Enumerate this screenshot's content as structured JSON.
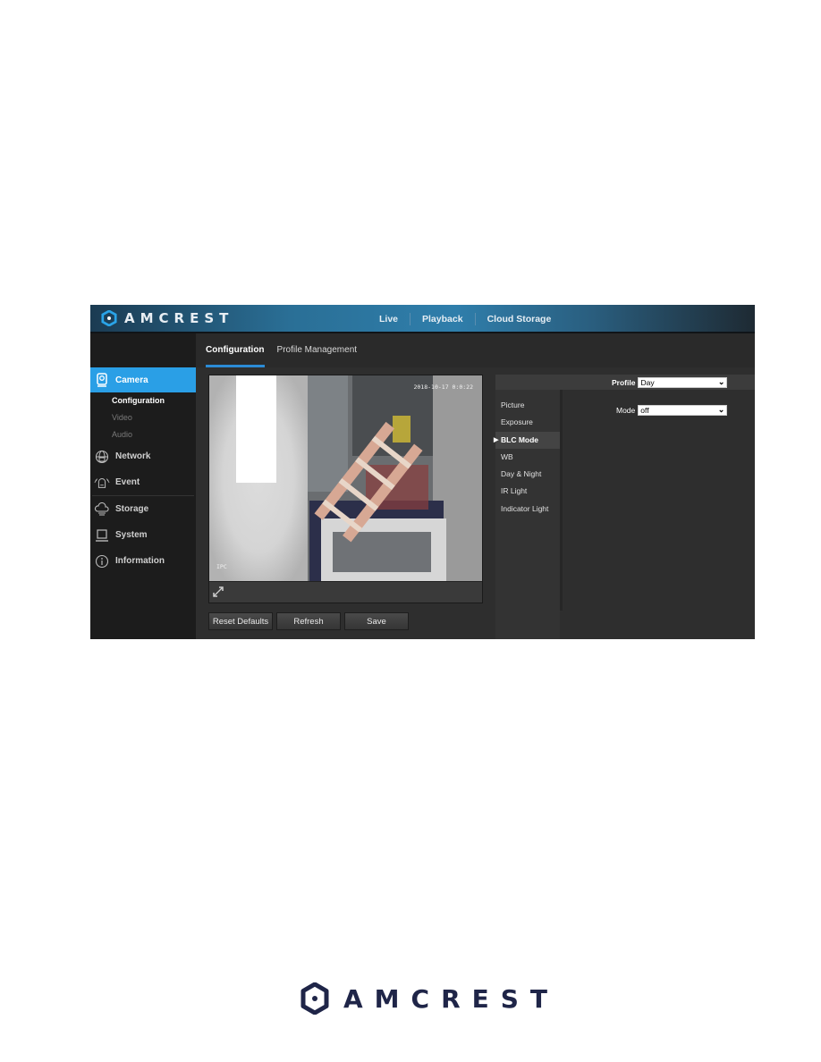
{
  "app": {
    "brand": "AMCREST",
    "top_nav": [
      {
        "label": "Live"
      },
      {
        "label": "Playback"
      },
      {
        "label": "Cloud Storage"
      }
    ],
    "tabs": [
      {
        "label": "Configuration",
        "active": true
      },
      {
        "label": "Profile Management",
        "active": false
      }
    ],
    "sidebar": {
      "camera": {
        "label": "Camera",
        "icon": "camera-icon"
      },
      "camera_subitems": [
        {
          "label": "Configuration",
          "active": true
        },
        {
          "label": "Video",
          "active": false
        },
        {
          "label": "Audio",
          "active": false
        }
      ],
      "network": {
        "label": "Network",
        "icon": "network-icon"
      },
      "event": {
        "label": "Event",
        "icon": "event-alarm-icon"
      },
      "storage": {
        "label": "Storage",
        "icon": "cloud-storage-icon"
      },
      "system": {
        "label": "System",
        "icon": "computer-icon"
      },
      "information": {
        "label": "Information",
        "icon": "info-icon"
      }
    },
    "video": {
      "osd_time": "2018-10-17 0:0:22",
      "osd_label": "IPC"
    },
    "buttons": {
      "reset": "Reset Defaults",
      "refresh": "Refresh",
      "save": "Save"
    },
    "settings_menu": [
      {
        "label": "Picture",
        "active": false
      },
      {
        "label": "Exposure",
        "active": false
      },
      {
        "label": "BLC Mode",
        "active": true
      },
      {
        "label": "WB",
        "active": false
      },
      {
        "label": "Day & Night",
        "active": false
      },
      {
        "label": "IR Light",
        "active": false
      },
      {
        "label": "Indicator Light",
        "active": false
      }
    ],
    "profile": {
      "label": "Profile",
      "value": "Day"
    },
    "mode": {
      "label": "Mode",
      "value": "off"
    },
    "colors": {
      "accent": "#2a9fe6",
      "sidebar_bg": "#1c1c1c",
      "content_bg": "#2e2e2e"
    }
  },
  "footer": {
    "brand": "AMCREST",
    "color": "#1f2548"
  }
}
